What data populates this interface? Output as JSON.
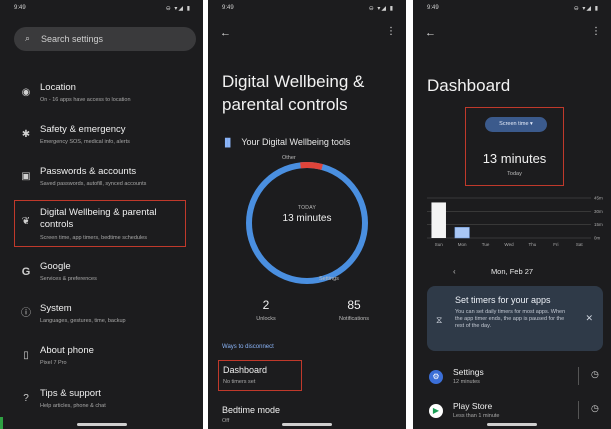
{
  "status": {
    "time": "9:49",
    "icons": "⊖ ▾◢ ▮"
  },
  "settings": {
    "search_placeholder": "Search settings",
    "items": [
      {
        "title": "Location",
        "subtitle": "On - 16 apps have access to location",
        "icon": "location-pin-icon"
      },
      {
        "title": "Safety & emergency",
        "subtitle": "Emergency SOS, medical info, alerts",
        "icon": "asterisk-icon"
      },
      {
        "title": "Passwords & accounts",
        "subtitle": "Saved passwords, autofill, synced accounts",
        "icon": "account-card-icon"
      },
      {
        "title": "Digital Wellbeing & parental controls",
        "subtitle": "Screen time, app timers, bedtime schedules",
        "icon": "wellbeing-icon"
      },
      {
        "title": "Google",
        "subtitle": "Services & preferences",
        "icon": "google-icon"
      },
      {
        "title": "System",
        "subtitle": "Languages, gestures, time, backup",
        "icon": "info-icon"
      },
      {
        "title": "About phone",
        "subtitle": "Pixel 7 Pro",
        "icon": "phone-icon"
      },
      {
        "title": "Tips & support",
        "subtitle": "Help articles, phone & chat",
        "icon": "help-icon"
      }
    ]
  },
  "wellbeing": {
    "title": "Digital Wellbeing & parental controls",
    "tools_label": "Your Digital Wellbeing tools",
    "ring_other_label": "Other",
    "ring_today_label": "TODAY",
    "ring_time": "13 minutes",
    "ring_settings_label": "Settings",
    "ring_other_fraction": 0.06,
    "stats": [
      {
        "value": "2",
        "label": "Unlocks"
      },
      {
        "value": "85",
        "label": "Notifications"
      }
    ],
    "ways_label": "Ways to disconnect",
    "dashboard": {
      "title": "Dashboard",
      "subtitle": "No timers set"
    },
    "bedtime": {
      "title": "Bedtime mode",
      "subtitle": "Off"
    }
  },
  "dashboard": {
    "title": "Dashboard",
    "dropdown_label": "Screen time ▾",
    "screen_time": "13 minutes",
    "screen_time_sub": "Today",
    "date": "Mon, Feb 27",
    "prev_arrow": "‹",
    "timer_card": {
      "title": "Set timers for your apps",
      "body": "You can set daily timers for most apps. When the app timer ends, the app is paused for the rest of the day."
    },
    "apps": [
      {
        "name": "Settings",
        "time": "12 minutes",
        "icon": "settings-gear-icon"
      },
      {
        "name": "Play Store",
        "time": "Less than 1 minute",
        "icon": "play-store-icon"
      }
    ]
  },
  "chart_data": {
    "type": "bar",
    "categories": [
      "Sun",
      "Mon",
      "Tue",
      "Wed",
      "Thu",
      "Fri",
      "Sat"
    ],
    "values": [
      40,
      12,
      0,
      0,
      0,
      0,
      0
    ],
    "y_tick_labels": [
      "45m",
      "30m",
      "15m",
      "0m"
    ],
    "ylim": [
      0,
      45
    ],
    "grid": true,
    "highlight_index": 1
  }
}
